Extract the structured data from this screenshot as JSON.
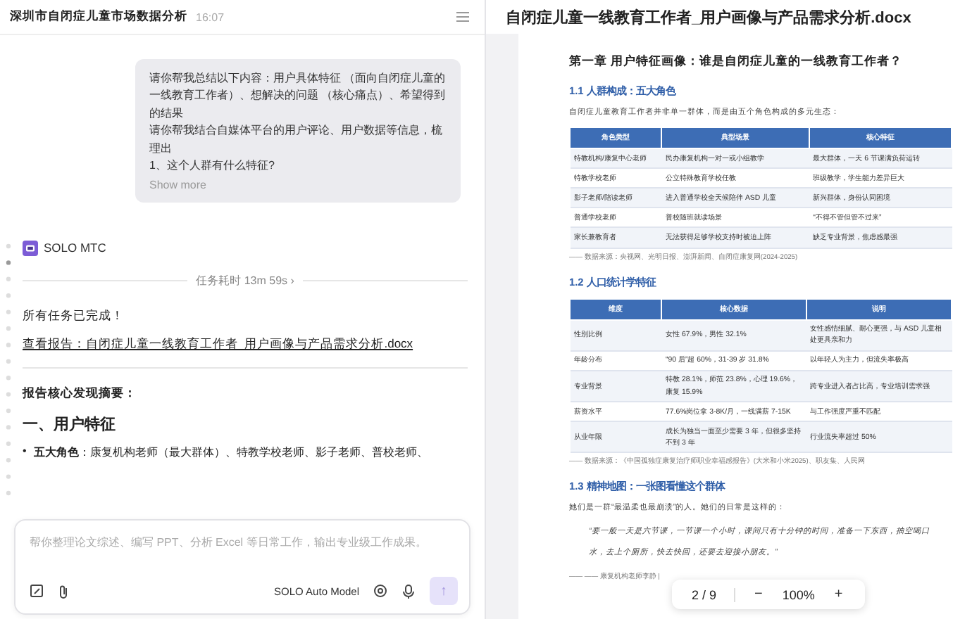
{
  "chat": {
    "title": "深圳市自闭症儿童市场数据分析",
    "time": "16:07",
    "user_message": {
      "lines": [
        "请你帮我总结以下内容：用户具体特征 （面向自闭症儿童的一线教育工作者）、想解决的问题 （核心痛点）、希望得到的结果",
        "请你帮我结合自媒体平台的用户评论、用户数据等信息，梳理出",
        "1、这个人群有什么特征?"
      ],
      "more": "Show more"
    },
    "agent": {
      "name": "SOLO MTC"
    },
    "duration": "任务耗时 13m 59s",
    "duration_chevron": "›",
    "done": "所有任务已完成！",
    "report_link": "查看报告：自闭症儿童一线教育工作者_用户画像与产品需求分析.docx",
    "summary_title": "报告核心发现摘要：",
    "section": "一、用户特征",
    "bullet_marker": "•",
    "bullets": [
      "**五大角色**：康复机构老师（最大群体）、特教学校老师、影子老师、普校老师、"
    ]
  },
  "composer": {
    "placeholder": "帮你整理论文综述、编写 PPT、分析 Excel 等日常工作，输出专业级工作成果。",
    "model": "SOLO Auto Model",
    "send": "↑"
  },
  "document": {
    "file_name": "自闭症儿童一线教育工作者_用户画像与产品需求分析.docx",
    "chapter": "第一章  用户特征画像：谁是自闭症儿童的一线教育工作者？",
    "sections": [
      {
        "heading": "1.1 人群构成：五大角色",
        "paragraph": "自闭症儿童教育工作者并非单一群体，而是由五个角色构成的多元生态：",
        "table": {
          "columns": [
            "角色类型",
            "典型场景",
            "核心特征"
          ],
          "rows": [
            [
              "特教机构/康复中心老师",
              "民办康复机构一对一或小组教学",
              "最大群体，一天 6 节课满负荷运转"
            ],
            [
              "特教学校老师",
              "公立特殊教育学校任教",
              "班级教学，学生能力差异巨大"
            ],
            [
              "影子老师/陪读老师",
              "进入普通学校全天候陪伴 ASD 儿童",
              "新兴群体，身份认同困境"
            ],
            [
              "普通学校老师",
              "普校随班就读场景",
              "“不得不管但管不过来”"
            ],
            [
              "家长兼教育者",
              "无法获得足够学校支持时被迫上阵",
              "缺乏专业背景，焦虑感最强"
            ]
          ]
        },
        "source": "—— 数据来源：央视网、光明日报、澎湃新闻、自闭症康复网(2024-2025)"
      },
      {
        "heading": "1.2 人口统计学特征",
        "table": {
          "columns": [
            "维度",
            "核心数据",
            "说明"
          ],
          "rows": [
            [
              "性别比例",
              "女性 67.9%，男性 32.1%",
              "女性感情细腻、耐心更强，与 ASD 儿童相处更具亲和力"
            ],
            [
              "年龄分布",
              "“90 后”超 60%，31-39 岁 31.8%",
              "以年轻人为主力，但流失率极高"
            ],
            [
              "专业背景",
              "特教 28.1%，师范 23.8%，心理 19.6%，康复 15.9%",
              "跨专业进入者占比高，专业培训需求强"
            ],
            [
              "薪资水平",
              "77.6%岗位拿 3-8K/月，一线满薪 7-15K",
              "与工作强度严重不匹配"
            ],
            [
              "从业年限",
              "成长为独当一面至少需要 3 年，但很多坚持不到 3 年",
              "行业流失率超过 50%"
            ]
          ]
        },
        "source": "—— 数据来源：《中国孤独症康复治疗师职业幸福感报告》(大米和小米2025)、职友集、人民网"
      },
      {
        "heading": "1.3 精神地图：一张图看懂这个群体",
        "paragraph": "她们是一群“最温柔也最崩溃”的人。她们的日常是这样的：",
        "quote": "“要一般一天是六节课，一节课一个小时，课间只有十分钟的时间，准备一下东西，抽空喝口水，去上个厕所，快去快回，还要去迎接小朋友。”",
        "attribution": "—— —— 康复机构老师李静 |"
      }
    ]
  },
  "pager": {
    "page": "2 / 9",
    "minus": "−",
    "zoom": "100%",
    "plus": "+"
  }
}
